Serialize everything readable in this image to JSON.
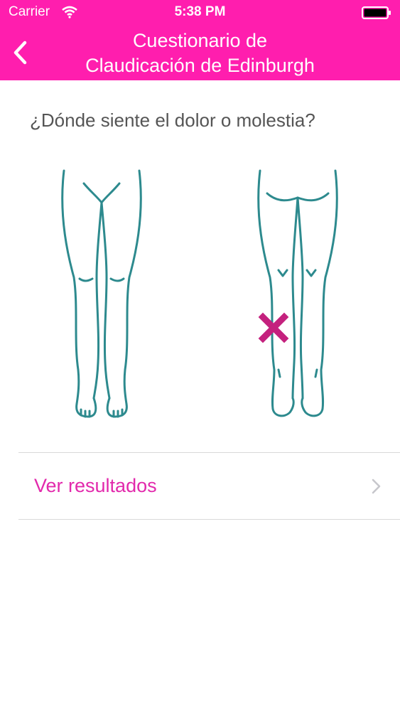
{
  "status_bar": {
    "carrier": "Carrier",
    "time": "5:38 PM",
    "icons": [
      "wifi-icon",
      "battery-icon"
    ]
  },
  "nav": {
    "title_line1": "Cuestionario de",
    "title_line2": "Claudicación de Edinburgh",
    "back_icon": "chevron-left-icon"
  },
  "question": "¿Dónde siente el dolor o molestia?",
  "diagram": {
    "front_view": "legs-front",
    "back_view": "legs-back",
    "marker": "x-mark-icon",
    "marker_location": "left calf (back view)"
  },
  "result_row": {
    "label": "Ver resultados",
    "icon": "chevron-right-icon"
  },
  "colors": {
    "header_bg": "#ff1eae",
    "accent_text": "#e229ac",
    "leg_outline": "#2d8a8e",
    "marker": "#c4217e",
    "divider": "#d9d9d9"
  }
}
